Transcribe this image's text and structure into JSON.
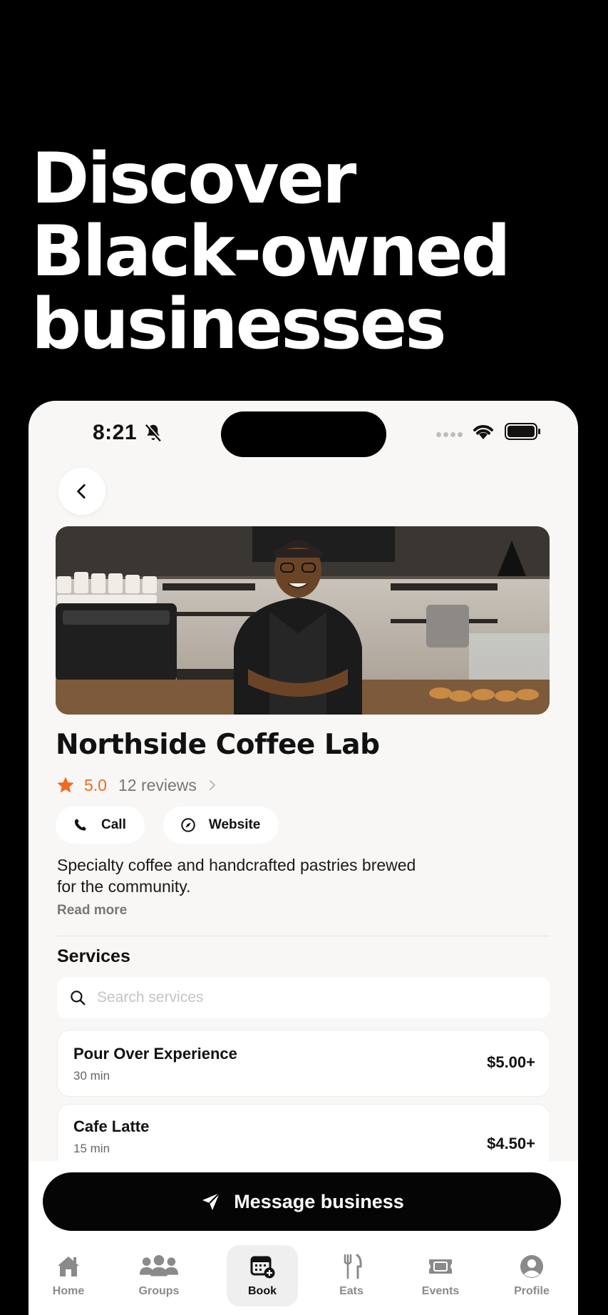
{
  "hero": {
    "line1": "Discover",
    "line2": "Black-owned",
    "line3": "businesses"
  },
  "status_bar": {
    "time": "8:21"
  },
  "business": {
    "name": "Northside Coffee Lab",
    "rating": "5.0",
    "review_count": "12 reviews",
    "description": "Specialty coffee and handcrafted pastries brewed for the community.",
    "read_more": "Read more"
  },
  "actions": {
    "call_label": "Call",
    "website_label": "Website"
  },
  "services": {
    "title": "Services",
    "search_placeholder": "Search services",
    "items": [
      {
        "name": "Pour Over Experience",
        "duration": "30 min",
        "price": "$5.00+"
      },
      {
        "name": "Cafe Latte",
        "duration": "15 min",
        "price": "$4.50+"
      }
    ]
  },
  "message_button": {
    "label": "Message business"
  },
  "tabbar": {
    "items": [
      {
        "label": "Home",
        "icon": "home-icon"
      },
      {
        "label": "Groups",
        "icon": "groups-icon"
      },
      {
        "label": "Book",
        "icon": "book-calendar-icon",
        "active": true
      },
      {
        "label": "Eats",
        "icon": "utensils-icon"
      },
      {
        "label": "Events",
        "icon": "ticket-icon"
      },
      {
        "label": "Profile",
        "icon": "profile-icon"
      }
    ]
  },
  "colors": {
    "accent_star": "#f06a1f",
    "background": "#f8f7f5",
    "button": "#050505"
  }
}
